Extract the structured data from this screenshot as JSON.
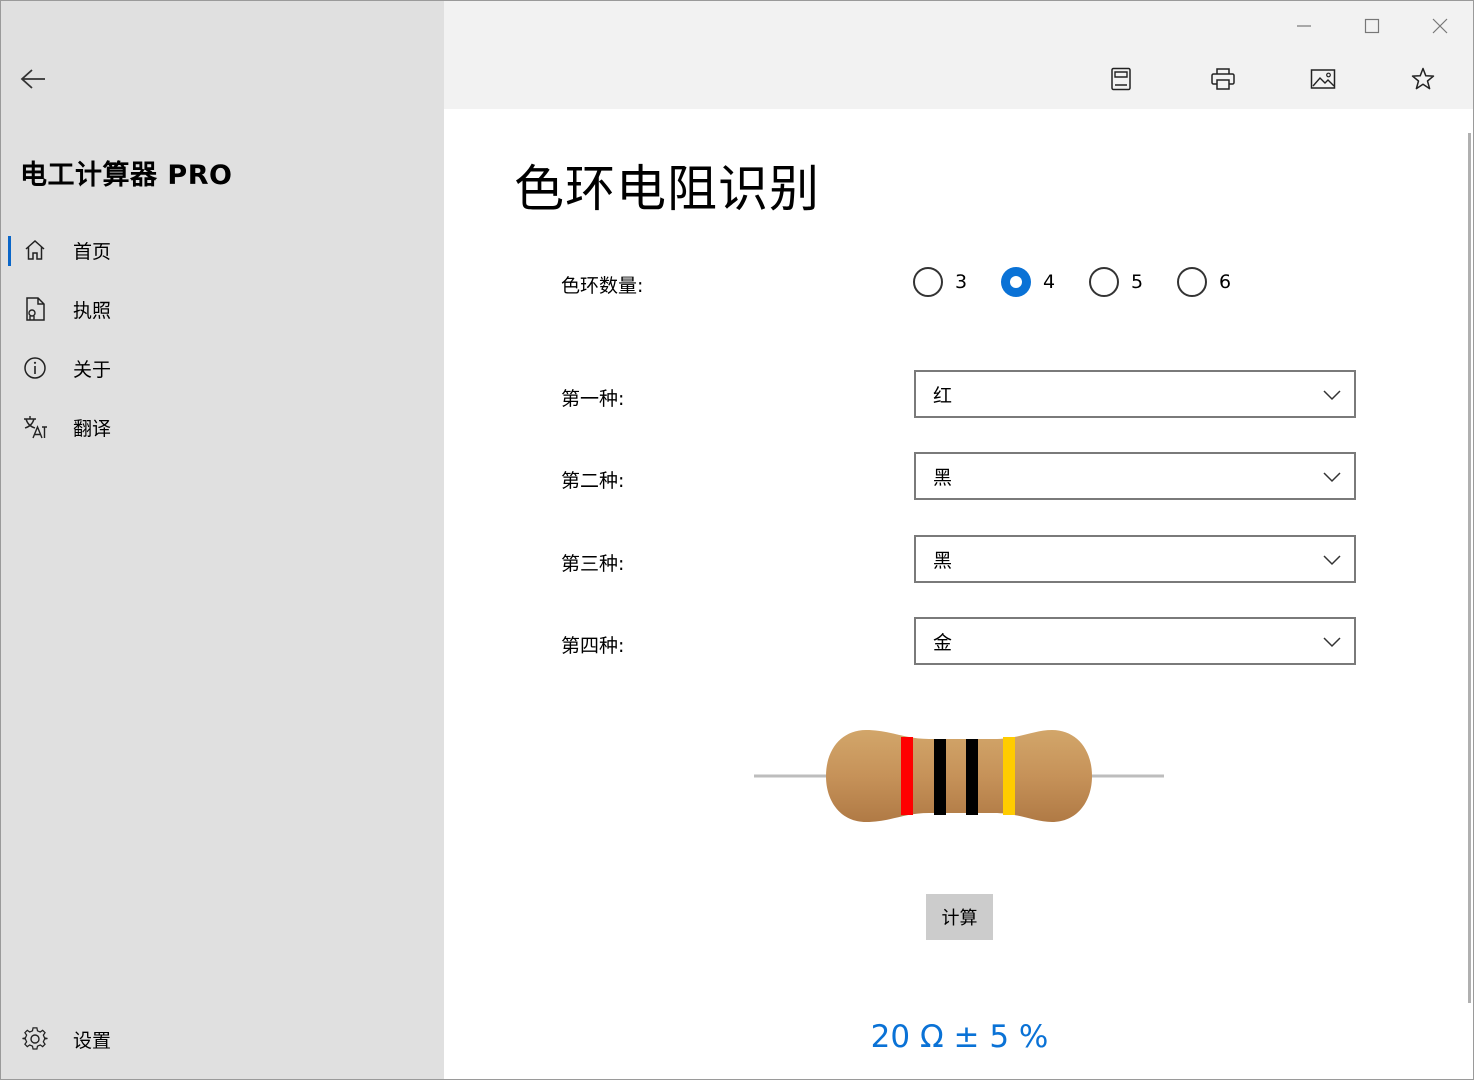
{
  "app": {
    "title": "电工计算器 PRO"
  },
  "sidebar": {
    "items": [
      {
        "label": "首页",
        "icon": "home-icon",
        "selected": true
      },
      {
        "label": "执照",
        "icon": "document-icon",
        "selected": false
      },
      {
        "label": "关于",
        "icon": "info-icon",
        "selected": false
      },
      {
        "label": "翻译",
        "icon": "translate-icon",
        "selected": false
      }
    ],
    "settings": {
      "label": "设置",
      "icon": "gear-icon"
    }
  },
  "toolbar": {
    "icons": [
      "reading-view-icon",
      "print-icon",
      "image-icon",
      "favorite-star-icon"
    ]
  },
  "page": {
    "title": "色环电阻识别",
    "band_count_label": "色环数量:",
    "band_options": [
      "3",
      "4",
      "5",
      "6"
    ],
    "band_count_selected": "4",
    "bands": [
      {
        "label": "第一种:",
        "value": "红"
      },
      {
        "label": "第二种:",
        "value": "黑"
      },
      {
        "label": "第三种:",
        "value": "黑"
      },
      {
        "label": "第四种:",
        "value": "金"
      }
    ],
    "resistor_band_colors": [
      "#ff0000",
      "#000000",
      "#000000",
      "#ffcc00"
    ],
    "calculate_label": "计算",
    "result": "20 Ω ± 5 %"
  },
  "colors": {
    "accent": "#0a72d6",
    "sidebar_bg": "#e0e0e0",
    "topbar_bg": "#f2f2f2"
  }
}
